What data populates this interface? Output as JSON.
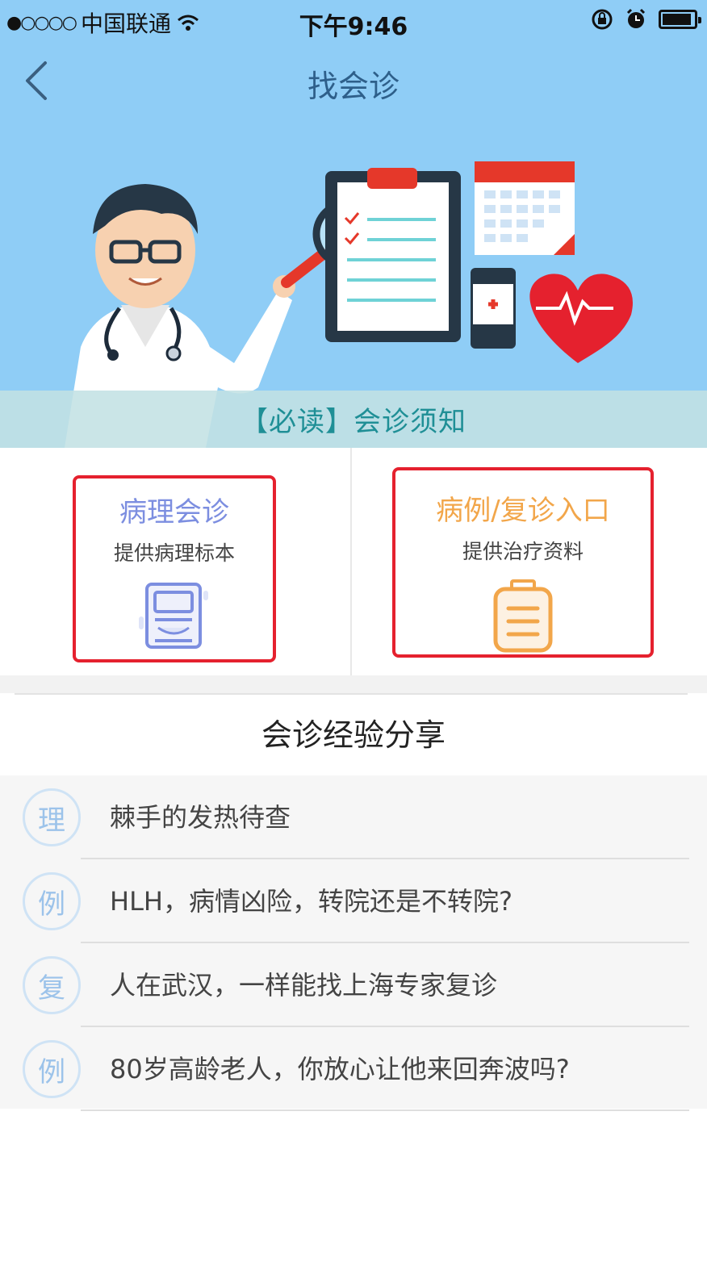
{
  "status_bar": {
    "signal": "●○○○○",
    "carrier": "中国联通",
    "time": "下午9:46"
  },
  "navbar": {
    "title": "找会诊"
  },
  "notice": {
    "text": "【必读】会诊须知"
  },
  "entries": [
    {
      "title": "病理会诊",
      "subtitle": "提供病理标本",
      "icon": "specimen-slide-icon",
      "color": "#7c8ee0"
    },
    {
      "title": "病例/复诊入口",
      "subtitle": "提供治疗资料",
      "icon": "clipboard-icon",
      "color": "#f2a64a"
    }
  ],
  "share": {
    "title": "会诊经验分享",
    "items": [
      {
        "badge": "理",
        "text": "棘手的发热待查"
      },
      {
        "badge": "例",
        "text": "HLH，病情凶险，转院还是不转院?"
      },
      {
        "badge": "复",
        "text": "人在武汉，一样能找上海专家复诊"
      },
      {
        "badge": "例",
        "text": "80岁高龄老人，你放心让他来回奔波吗?"
      }
    ]
  },
  "colors": {
    "banner": "#8fcdf6",
    "highlight_border": "#e5212e",
    "notice_text": "#1f8f96"
  }
}
